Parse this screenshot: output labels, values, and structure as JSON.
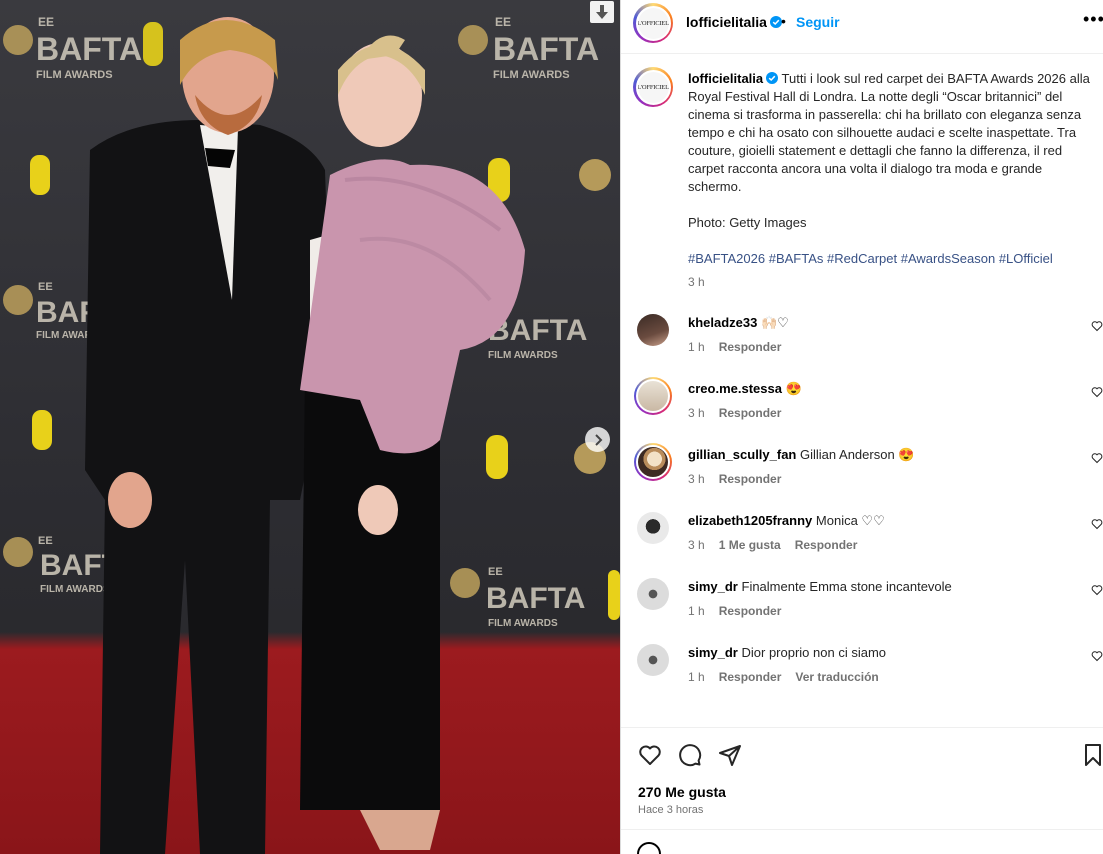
{
  "media": {
    "download_icon": "arrow-down-icon",
    "next_icon": "chevron-right-icon",
    "backdrop_text": {
      "ee": "EE",
      "bafta": "BAFTA",
      "film_awards": "FILM AWARDS"
    }
  },
  "header": {
    "avatar_text": "L'OFFICIEL",
    "username": "lofficielitalia",
    "separator": "•",
    "follow_label": "Seguir",
    "more_label": "•••"
  },
  "caption": {
    "username": "lofficielitalia",
    "text": "Tutti i look sul red carpet dei BAFTA Awards 2026 alla Royal Festival Hall di Londra. La notte degli “Oscar britannici” del cinema si trasforma in passerella: chi ha brillato con eleganza senza tempo e chi ha osato con silhouette audaci e scelte inaspettate. Tra couture, gioielli statement e dettagli che fanno la differenza, il red carpet racconta ancora una volta il dialogo tra moda e grande schermo.",
    "photo_credit": "Photo: Getty Images",
    "hashtags": [
      "#BAFTA2026",
      "#BAFTAs",
      "#RedCarpet",
      "#AwardsSeason",
      "#LOfficiel"
    ],
    "time": "3 h"
  },
  "comments": [
    {
      "user": "kheladze33",
      "text": "🙌🏻♡",
      "time": "1 h",
      "reply": "Responder",
      "likes": "",
      "extra": ""
    },
    {
      "user": "creo.me.stessa",
      "text": "😍",
      "time": "3 h",
      "reply": "Responder",
      "likes": "",
      "extra": ""
    },
    {
      "user": "gillian_scully_fan",
      "text": "Gillian Anderson 😍",
      "time": "3 h",
      "reply": "Responder",
      "likes": "",
      "extra": ""
    },
    {
      "user": "elizabeth1205franny",
      "text": "Monica ♡♡",
      "time": "3 h",
      "reply": "Responder",
      "likes": "1 Me gusta",
      "extra": ""
    },
    {
      "user": "simy_dr",
      "text": "Finalmente Emma stone incantevole",
      "time": "1 h",
      "reply": "Responder",
      "likes": "",
      "extra": ""
    },
    {
      "user": "simy_dr",
      "text": "Dior proprio non ci siamo",
      "time": "1 h",
      "reply": "Responder",
      "likes": "",
      "extra": "Ver traducción"
    }
  ],
  "footer": {
    "likes": "270 Me gusta",
    "posted": "Hace 3 horas"
  },
  "colors": {
    "accent": "#0095f6",
    "hashtag": "#385185",
    "muted": "#737373",
    "carpet": "#9c1b1f",
    "backdrop": "#2e2e33"
  }
}
